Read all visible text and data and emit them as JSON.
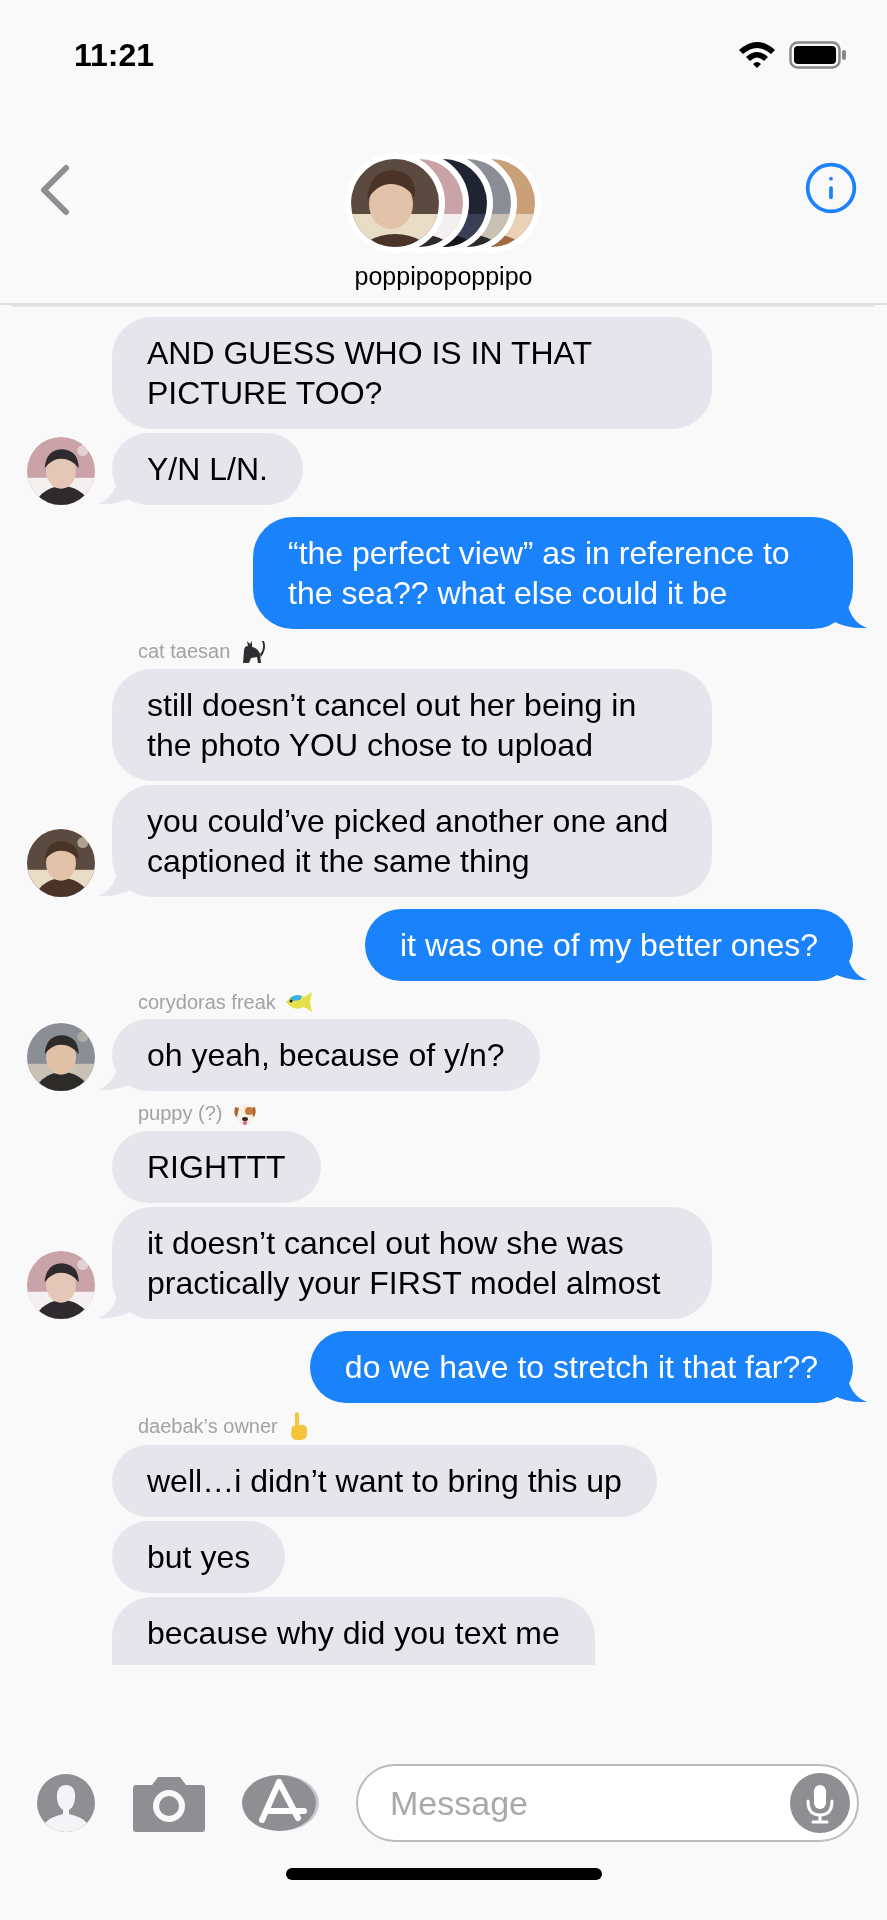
{
  "status_bar": {
    "time": "11:21"
  },
  "header": {
    "title": "poppipopoppipo"
  },
  "messages": [
    {
      "kind": "incoming",
      "text": "AND GUESS WHO IS IN THAT PICTURE TOO?",
      "tail": false,
      "avatar": false
    },
    {
      "kind": "incoming",
      "text": "Y/N L/N.",
      "tail": true,
      "avatar": true
    },
    {
      "kind": "outgoing",
      "text": "“the perfect view” as in reference to the sea?? what else could it be",
      "tail": true
    },
    {
      "kind": "sender",
      "name": "cat taesan",
      "badge": {
        "kind": "cat"
      }
    },
    {
      "kind": "incoming",
      "text": "still doesn’t cancel out her being in the photo YOU chose to upload",
      "tail": false,
      "avatar": false
    },
    {
      "kind": "incoming",
      "text": "you could’ve picked another one and captioned it the same thing",
      "tail": true,
      "avatar": true
    },
    {
      "kind": "outgoing",
      "text": "it was one of my better ones?",
      "tail": true
    },
    {
      "kind": "sender",
      "name": "corydoras freak",
      "badge": {
        "kind": "fish"
      }
    },
    {
      "kind": "incoming",
      "text": "oh yeah, because of y/n?",
      "tail": true,
      "avatar": true
    },
    {
      "kind": "sender",
      "name": "puppy (?)",
      "badge": {
        "kind": "dog"
      }
    },
    {
      "kind": "incoming",
      "text": "RIGHTTT",
      "tail": false,
      "avatar": false
    },
    {
      "kind": "incoming",
      "text": "it doesn’t cancel out how she was practically your FIRST model almost",
      "tail": true,
      "avatar": true
    },
    {
      "kind": "outgoing",
      "text": "do we have to stretch it that far??",
      "tail": true
    },
    {
      "kind": "sender",
      "name": "daebak’s owner",
      "badge": {
        "kind": "finger"
      }
    },
    {
      "kind": "incoming",
      "text": "well…i didn’t want to bring this up",
      "tail": false,
      "avatar": false
    },
    {
      "kind": "incoming",
      "text": "but yes",
      "tail": false,
      "avatar": false
    },
    {
      "kind": "incoming",
      "text": "because why did you text me",
      "tail": false,
      "avatar": false,
      "cut_off": true
    }
  ],
  "composer": {
    "placeholder": "Message"
  }
}
